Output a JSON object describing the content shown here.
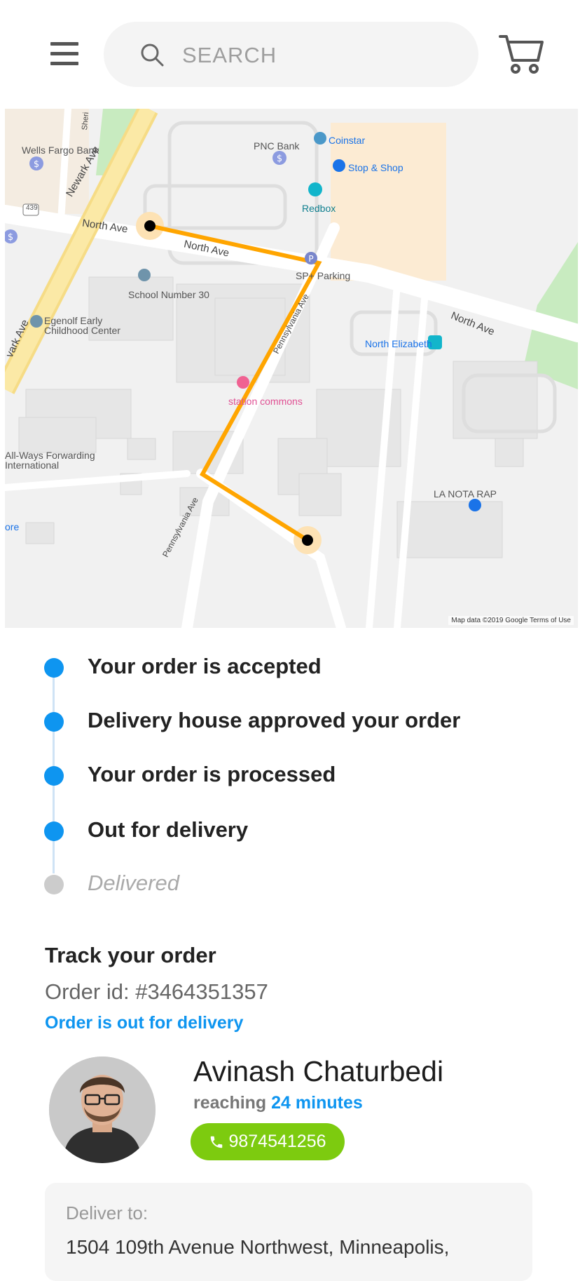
{
  "header": {
    "search_placeholder": "SEARCH",
    "menu_icon": "hamburger-menu-icon",
    "cart_icon": "shopping-cart-icon"
  },
  "map": {
    "place_labels": {
      "wells_fargo": "Wells Fargo Bank",
      "pnc": "PNC Bank",
      "coinstar": "Coinstar",
      "stop_shop": "Stop & Shop",
      "redbox": "Redbox",
      "sp_parking": "SP+ Parking",
      "school": "School Number 30",
      "egenolf": "Egenolf Early Childhood Center",
      "north_elizabeth": "North Elizabeth",
      "station_commons": "station commons",
      "all_ways": "All-Ways Forwarding International",
      "la_nota": "LA NOTA RAP",
      "ore": "ore"
    },
    "road_labels": {
      "newark_ave_1": "Newark Ave",
      "newark_ave_2": "vark Ave",
      "north_ave_1": "North Ave",
      "north_ave_2": "North Ave",
      "north_ave_3": "North Ave",
      "pennsylvania_1": "Pennsylvania Ave",
      "pennsylvania_2": "Pennsylvania Ave",
      "sheri": "Sheri",
      "route_439": "439"
    },
    "attribution": "Map data ©2019 Google   Terms of Use",
    "route_color": "#FFA500",
    "route_start": "origin",
    "route_end": "destination"
  },
  "timeline": {
    "steps": [
      {
        "label": "Your order is accepted",
        "status": "done"
      },
      {
        "label": "Delivery house approved your order",
        "status": "done"
      },
      {
        "label": "Your order is processed",
        "status": "done"
      },
      {
        "label": "Out for delivery",
        "status": "done"
      },
      {
        "label": "Delivered",
        "status": "pending"
      }
    ]
  },
  "tracking": {
    "title": "Track your order",
    "order_id": "Order id: #3464351357",
    "status": "Order is out for delivery"
  },
  "driver": {
    "name": "Avinash Chaturbedi",
    "reaching_label": "reaching",
    "eta": "24 minutes",
    "phone": "9874541256"
  },
  "delivery": {
    "label": "Deliver to:",
    "address": "1504 109th Avenue Northwest, Minneapolis,"
  },
  "colors": {
    "accent_blue": "#0E95F0",
    "call_green": "#7DCB0F",
    "pending_gray": "#CCCCCC"
  }
}
